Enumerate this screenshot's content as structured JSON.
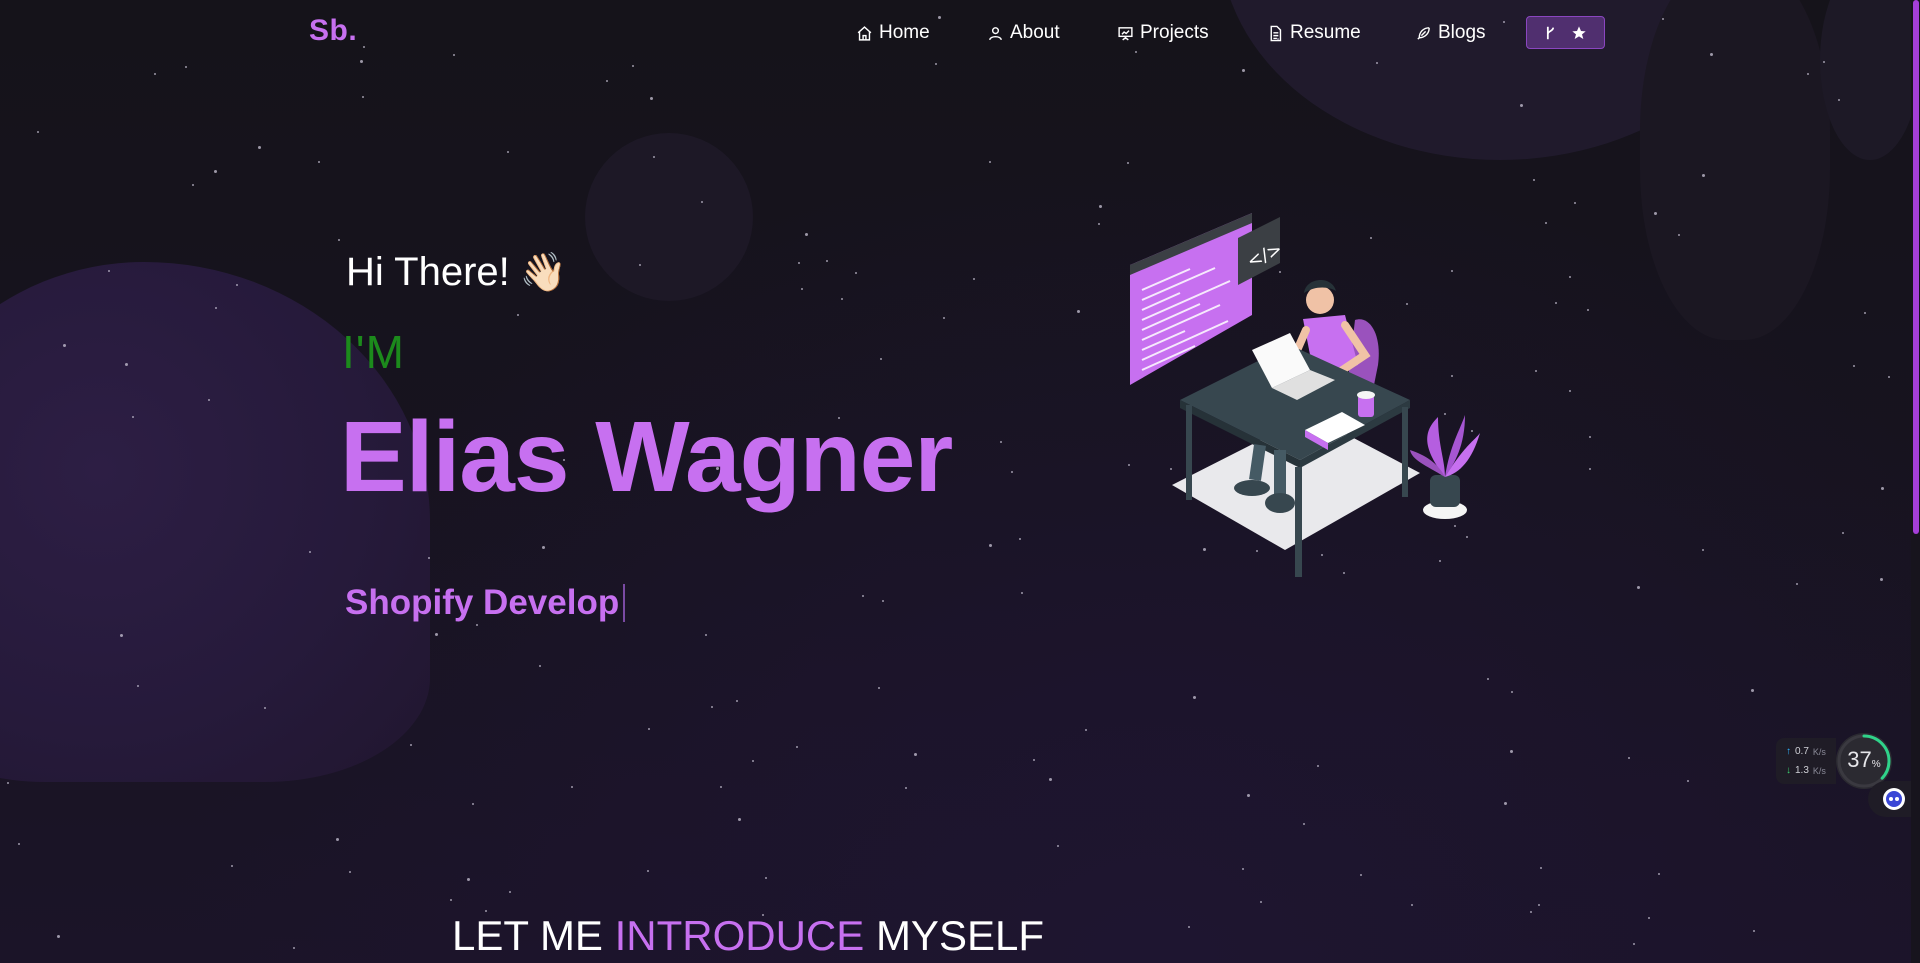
{
  "brand": {
    "logo": "Sb.",
    "accent_color": "#c770f0"
  },
  "nav": {
    "items": [
      {
        "label": "Home",
        "icon": "home-icon"
      },
      {
        "label": "About",
        "icon": "user-icon"
      },
      {
        "label": "Projects",
        "icon": "presentation-icon"
      },
      {
        "label": "Resume",
        "icon": "document-icon"
      },
      {
        "label": "Blogs",
        "icon": "feather-icon"
      }
    ],
    "fork_button": {
      "icons": [
        "git-fork-icon",
        "star-icon"
      ]
    }
  },
  "hero": {
    "greeting": "Hi There!",
    "greeting_emoji": "👋🏻",
    "intro": "I'M",
    "name": "Elias Wagner",
    "typewriter_text": "Shopify Develop"
  },
  "intro_section": {
    "title_part1": "LET ME ",
    "title_accent": "INTRODUCE",
    "title_part2": " MYSELF"
  },
  "system_widget": {
    "upload_speed": "0.7",
    "upload_unit": "K/s",
    "download_speed": "1.3",
    "download_unit": "K/s",
    "cpu_value": "37",
    "cpu_unit": "%"
  },
  "colors": {
    "background": "#16131c",
    "intro_green": "#1c8a1c",
    "accent_purple": "#c770f0"
  }
}
